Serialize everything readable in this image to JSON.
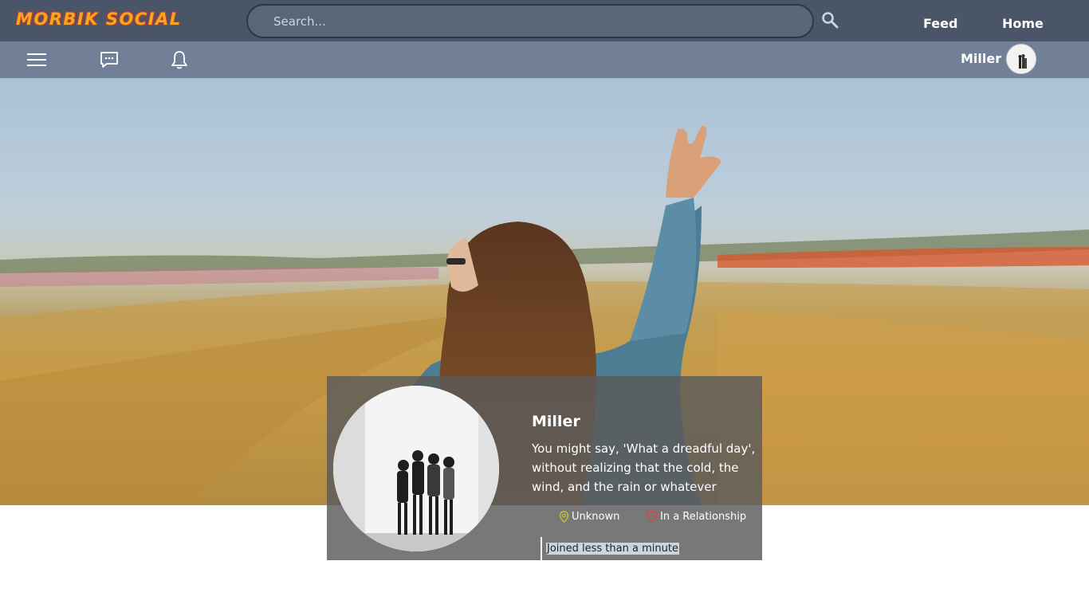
{
  "header": {
    "logo": "MORBIK SOCIAL",
    "search_placeholder": "Search...",
    "nav": {
      "feed": "Feed",
      "home": "Home"
    }
  },
  "subbar": {
    "icons": [
      "menu-icon",
      "chat-icon",
      "bell-icon"
    ],
    "user_name": "Miller"
  },
  "profile": {
    "name": "Miller",
    "bio": "You might say, 'What a dreadful day', without realizing that the cold, the wind, and the rain or whatever condition you",
    "location": "Unknown",
    "relationship": "In a Relationship",
    "joined": "Joined less than a minute"
  },
  "colors": {
    "topbar": "#4a5568",
    "subbar": "#718096",
    "logo": "#f5a623",
    "location_icon": "#c9c23a",
    "relationship_icon": "#e53e3e"
  }
}
